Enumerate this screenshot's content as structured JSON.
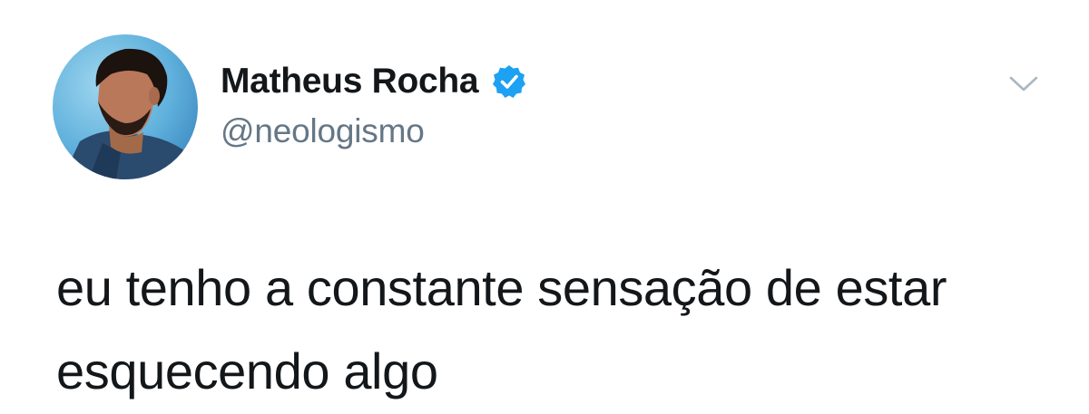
{
  "tweet": {
    "author": {
      "display_name": "Matheus Rocha",
      "handle": "@neologismo",
      "verified": true
    },
    "text": "eu tenho a constante sensação de estar esquecendo algo",
    "icons": {
      "verified": "verified-badge-icon",
      "menu": "chevron-down-icon"
    },
    "colors": {
      "verified_blue": "#1da1f2",
      "handle_gray": "#657786",
      "text": "#14171a",
      "caret_gray": "#aab8c2"
    }
  }
}
